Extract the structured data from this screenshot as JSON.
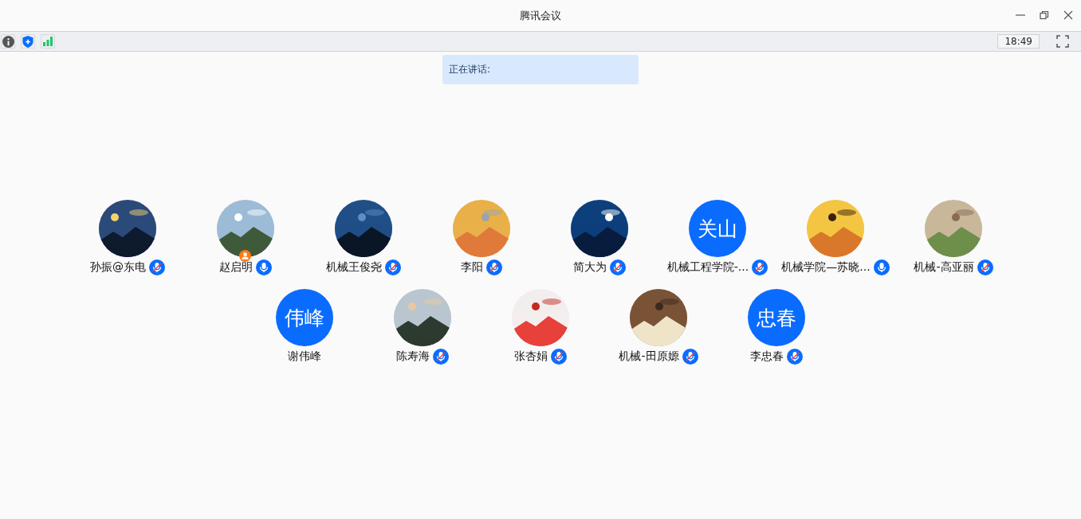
{
  "window": {
    "title": "腾讯会议"
  },
  "toolbar": {
    "clock": "18:49"
  },
  "speaking": {
    "label": "正在讲话:"
  },
  "participants": [
    {
      "name": "孙振@东电",
      "mic": {
        "muted": true
      },
      "host": false
    },
    {
      "name": "赵启明",
      "mic": {
        "muted": false
      },
      "host": true
    },
    {
      "name": "机械王俊尧",
      "mic": {
        "muted": true
      },
      "host": false
    },
    {
      "name": "李阳",
      "mic": {
        "muted": true
      },
      "host": false
    },
    {
      "name": "简大为",
      "mic": {
        "muted": true
      },
      "host": false
    },
    {
      "name": "机械工程学院-...",
      "avatar": {
        "kind": "initials",
        "text": "关山"
      },
      "mic": {
        "muted": true
      },
      "host": false
    },
    {
      "name": "机械学院—苏晓...",
      "mic": {
        "muted": false
      },
      "host": false
    },
    {
      "name": "机械-高亚丽",
      "mic": {
        "muted": true
      },
      "host": false
    },
    {
      "name": "谢伟峰",
      "avatar": {
        "kind": "initials",
        "text": "伟峰"
      },
      "host": false
    },
    {
      "name": "陈寿海",
      "mic": {
        "muted": true
      },
      "host": false
    },
    {
      "name": "张杏娟",
      "mic": {
        "muted": true
      },
      "host": false
    },
    {
      "name": "机械-田原嫄",
      "mic": {
        "muted": true
      },
      "host": false
    },
    {
      "name": "李忠春",
      "avatar": {
        "kind": "initials",
        "text": "忠春"
      },
      "mic": {
        "muted": true
      },
      "host": false
    }
  ]
}
